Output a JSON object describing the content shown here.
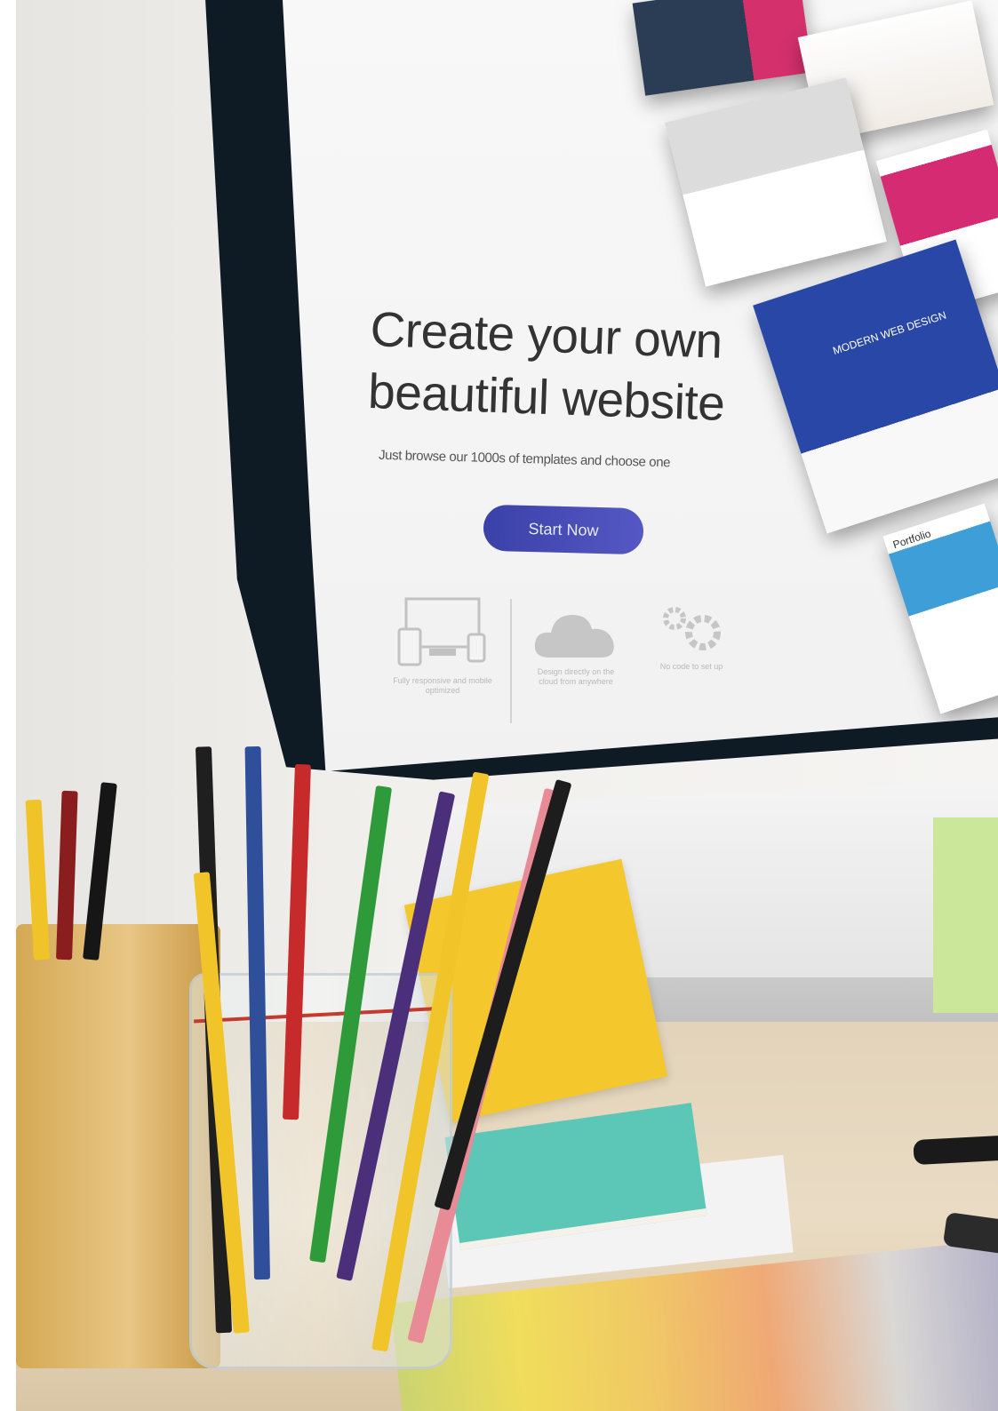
{
  "screen": {
    "hero_title": "Create your own\nbeautiful website",
    "hero_subtitle": "Just browse our 1000s of templates and choose one",
    "start_button_label": "Start Now",
    "features": [
      {
        "icon": "responsive-devices-icon",
        "caption": "Fully responsive and mobile optimized"
      },
      {
        "icon": "cloud-icon",
        "caption": "Design directly on the cloud from anywhere"
      },
      {
        "icon": "gears-icon",
        "caption": "No code to set up"
      }
    ],
    "template_cards": [
      {
        "text": ""
      },
      {
        "text": ""
      },
      {
        "text": ""
      },
      {
        "text": ""
      },
      {
        "text": "MODERN WEB DESIGN"
      },
      {
        "text": "Portfolio"
      }
    ]
  },
  "colors": {
    "button": "#4549b5",
    "bezel": "#0e1a24",
    "card_blue": "#2847a6",
    "card_pink": "#d52b72",
    "sticky_yellow": "#f4c72d",
    "notebook_teal": "#5cc7b6"
  }
}
